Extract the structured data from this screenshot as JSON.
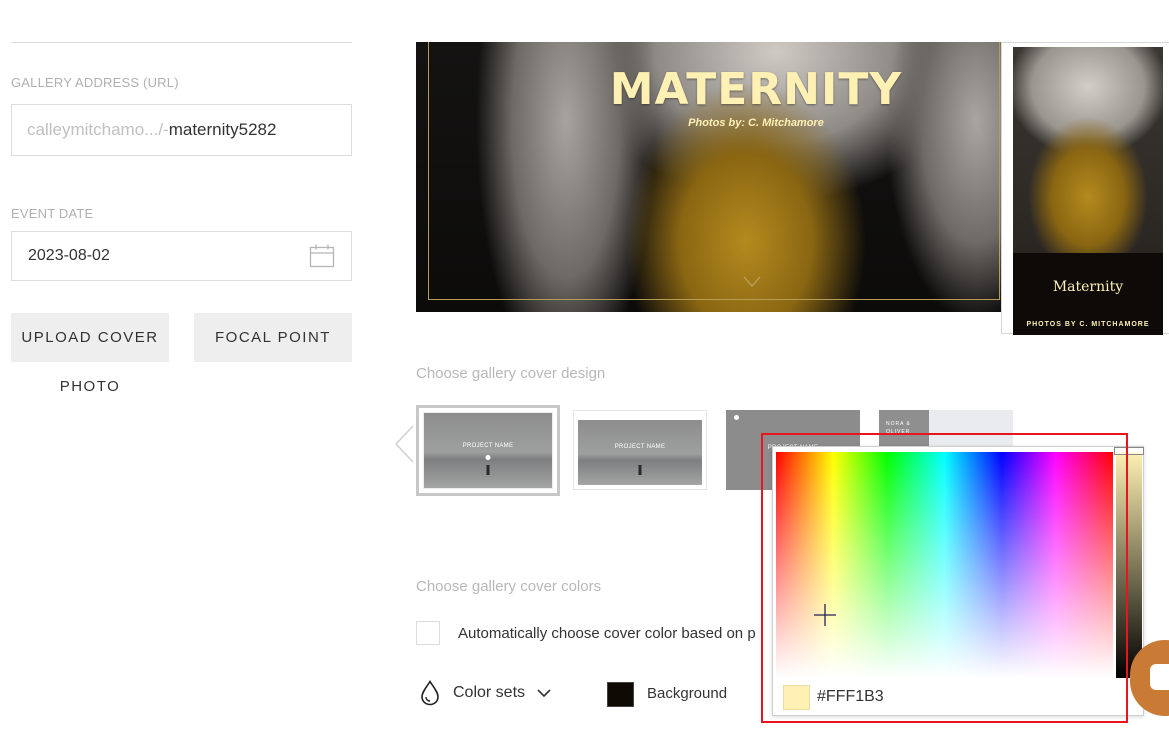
{
  "gallery_address": {
    "label": "GALLERY ADDRESS (URL)",
    "prefix": "calleymitchamo.../-",
    "slug": "maternity5282"
  },
  "event_date": {
    "label": "EVENT DATE",
    "value": "2023-08-02",
    "icon": "calendar-icon"
  },
  "buttons": {
    "upload_cover_line1": "UPLOAD COVER",
    "upload_cover_line2": "PHOTO",
    "focal_point": "FOCAL POINT"
  },
  "cover_preview": {
    "title": "MATERNITY",
    "subtitle": "Photos by: C. Mitchamore",
    "text_color": "#FFF1B3"
  },
  "mobile_preview": {
    "title": "Maternity",
    "credit": "PHOTOS BY C. MITCHAMORE"
  },
  "designs": {
    "label": "Choose gallery cover design",
    "items": [
      {
        "title": "PROJECT NAME",
        "selected": true
      },
      {
        "title": "PROJECT NAME",
        "selected": false
      },
      {
        "title": "PROJECT NAME",
        "selected": false
      },
      {
        "title": "NORA & OLIVER",
        "selected": false
      }
    ]
  },
  "colors": {
    "label": "Choose gallery cover colors",
    "auto_label": "Automatically choose cover color based on p",
    "auto_checked": false,
    "color_sets_label": "Color sets",
    "background_label": "Background",
    "background_color": "#0F0A04"
  },
  "picker": {
    "value": "#FFF1B3",
    "swatch_color": "#FFF1B3"
  }
}
